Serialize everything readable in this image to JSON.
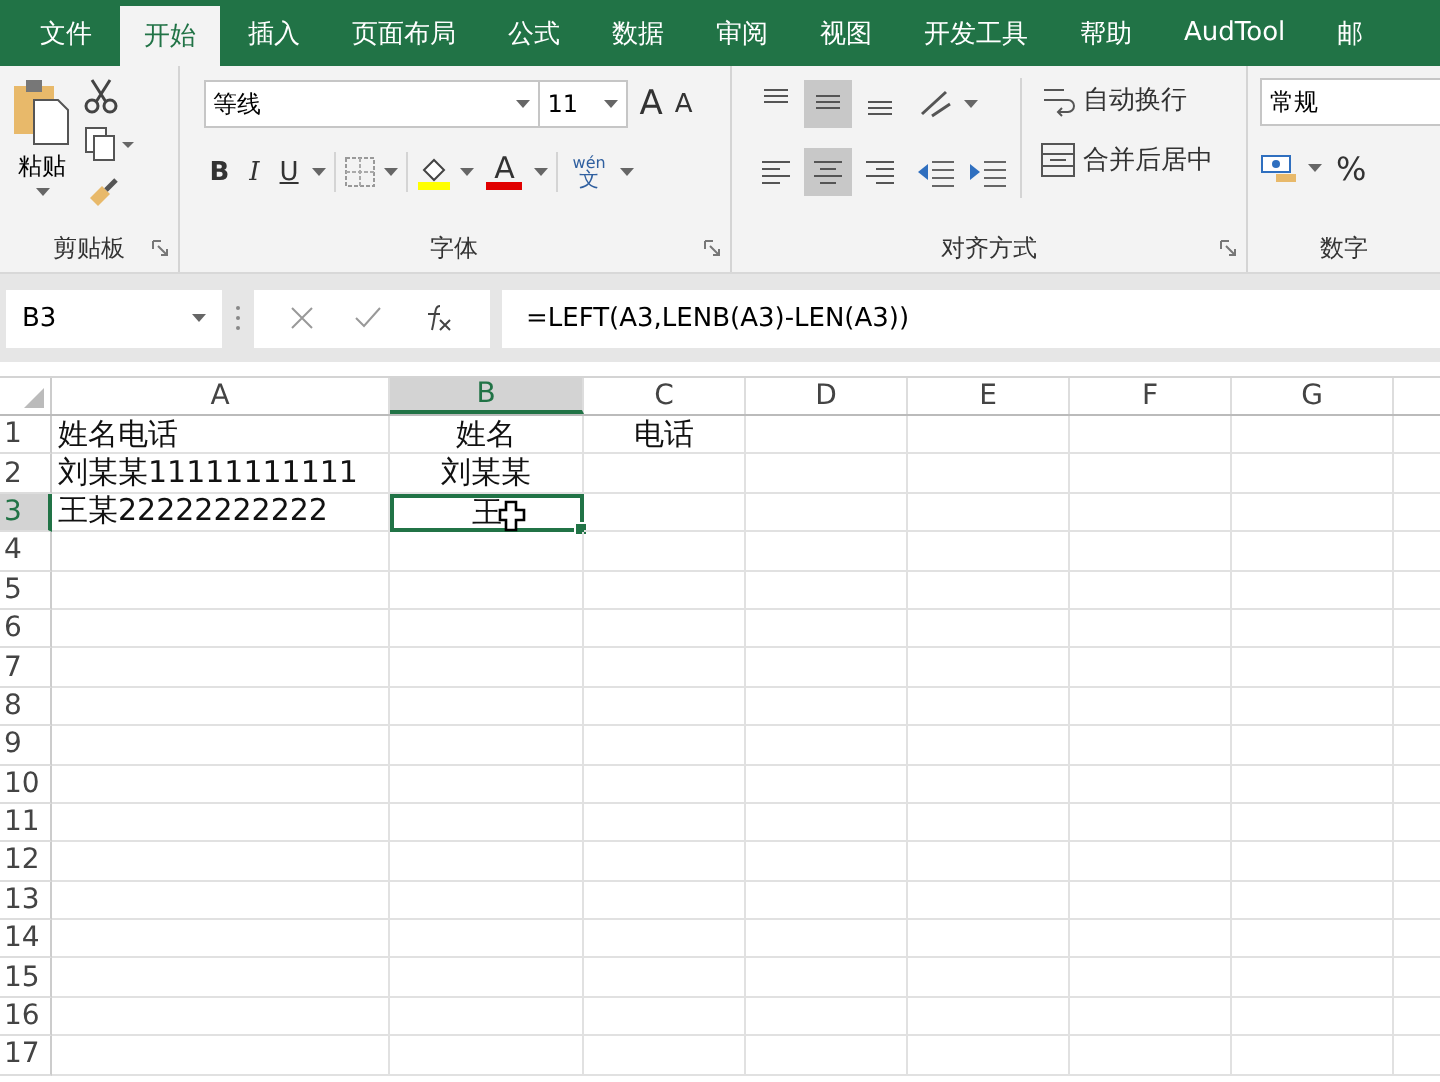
{
  "tabs": [
    {
      "label": "文件",
      "selected": false
    },
    {
      "label": "开始",
      "selected": true
    },
    {
      "label": "插入",
      "selected": false
    },
    {
      "label": "页面布局",
      "selected": false
    },
    {
      "label": "公式",
      "selected": false
    },
    {
      "label": "数据",
      "selected": false
    },
    {
      "label": "审阅",
      "selected": false
    },
    {
      "label": "视图",
      "selected": false
    },
    {
      "label": "开发工具",
      "selected": false
    },
    {
      "label": "帮助",
      "selected": false
    },
    {
      "label": "AudTool",
      "selected": false
    },
    {
      "label": "邮",
      "selected": false
    }
  ],
  "ribbon": {
    "clipboard": {
      "paste_label": "粘贴",
      "group_label": "剪贴板"
    },
    "font": {
      "font_name": "等线",
      "font_size": "11",
      "grow_glyph": "A",
      "shrink_glyph": "A",
      "bold_glyph": "B",
      "italic_glyph": "I",
      "underline_glyph": "U",
      "color_glyph": "A",
      "phonetic_top": "wén",
      "phonetic_bottom": "文",
      "group_label": "字体"
    },
    "alignment": {
      "top_row": [
        {
          "kind": "top",
          "on": false
        },
        {
          "kind": "middle",
          "on": true
        },
        {
          "kind": "bottom",
          "on": false
        }
      ],
      "bottom_row": [
        {
          "kind": "left",
          "on": false
        },
        {
          "kind": "center",
          "on": true
        },
        {
          "kind": "right",
          "on": false
        }
      ],
      "wrap_label": "自动换行",
      "merge_label": "合并后居中",
      "group_label": "对齐方式"
    },
    "number": {
      "format": "常规",
      "percent": "%",
      "group_label": "数字"
    }
  },
  "formula_bar": {
    "name_box": "B3",
    "formula": "=LEFT(A3,LENB(A3)-LEN(A3))"
  },
  "sheet": {
    "columns": [
      {
        "label": "A",
        "selected": false
      },
      {
        "label": "B",
        "selected": true
      },
      {
        "label": "C",
        "selected": false
      },
      {
        "label": "D",
        "selected": false
      },
      {
        "label": "E",
        "selected": false
      },
      {
        "label": "F",
        "selected": false
      },
      {
        "label": "G",
        "selected": false
      }
    ],
    "rows": [
      {
        "label": "1",
        "selected": false,
        "cells": [
          {
            "text": "姓名电话",
            "kind": "left",
            "active": false
          },
          {
            "text": "姓名",
            "kind": "center",
            "active": false
          },
          {
            "text": "电话",
            "kind": "center",
            "active": false
          }
        ]
      },
      {
        "label": "2",
        "selected": false,
        "cells": [
          {
            "text": "刘某某11111111111",
            "kind": "left",
            "active": false
          },
          {
            "text": "刘某某",
            "kind": "center",
            "active": false
          }
        ]
      },
      {
        "label": "3",
        "selected": true,
        "cells": [
          {
            "text": "王某22222222222",
            "kind": "left",
            "active": false
          },
          {
            "text": "王",
            "kind": "center",
            "active": true
          }
        ]
      },
      {
        "label": "4",
        "selected": false
      },
      {
        "label": "5",
        "selected": false
      },
      {
        "label": "6",
        "selected": false
      },
      {
        "label": "7",
        "selected": false
      },
      {
        "label": "8",
        "selected": false
      },
      {
        "label": "9",
        "selected": false
      },
      {
        "label": "10",
        "selected": false
      },
      {
        "label": "11",
        "selected": false
      },
      {
        "label": "12",
        "selected": false
      },
      {
        "label": "13",
        "selected": false
      },
      {
        "label": "14",
        "selected": false
      },
      {
        "label": "15",
        "selected": false
      },
      {
        "label": "16",
        "selected": false
      },
      {
        "label": "17",
        "selected": false
      }
    ]
  }
}
